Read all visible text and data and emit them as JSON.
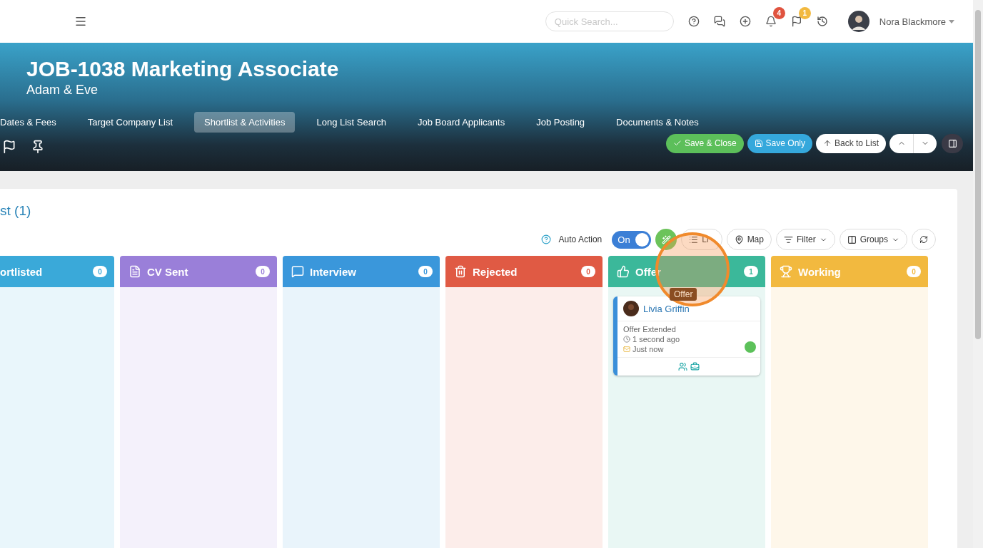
{
  "topbar": {
    "search": {
      "placeholder": "Quick Search..."
    },
    "badges": [
      {
        "kind": "bell",
        "count": "4",
        "color": "#e0533f"
      },
      {
        "kind": "flag",
        "count": "1",
        "color": "#f2b93f"
      }
    ],
    "user": {
      "name": "Nora Blackmore"
    }
  },
  "job": {
    "title": "JOB-1038 Marketing Associate",
    "company": "Adam & Eve"
  },
  "tabs": [
    {
      "label": "Dates & Fees",
      "selected": false
    },
    {
      "label": "Target Company List",
      "selected": false
    },
    {
      "label": "Shortlist & Activities",
      "selected": true
    },
    {
      "label": "Long List Search",
      "selected": false
    },
    {
      "label": "Job Board Applicants",
      "selected": false
    },
    {
      "label": "Job Posting",
      "selected": false
    },
    {
      "label": "Documents & Notes",
      "selected": false
    }
  ],
  "actions": [
    {
      "kind": "save-close",
      "label": "Save & Close"
    },
    {
      "kind": "save",
      "label": "Save Only"
    },
    {
      "kind": "back",
      "label": "Back to List"
    }
  ],
  "shortlist": {
    "title": "st (1)",
    "auto_action": {
      "label": "Auto Action",
      "state": "On",
      "on": true
    },
    "tools": [
      {
        "kind": "list",
        "label": "Li"
      },
      {
        "kind": "map",
        "label": "Map"
      },
      {
        "kind": "filter",
        "label": "Filter"
      },
      {
        "kind": "groups",
        "label": "Groups"
      }
    ],
    "tooltip": "Offer",
    "columns": [
      {
        "kind": "shortlisted",
        "name": "ortlisted",
        "count": "0",
        "color": "#3aa9d9"
      },
      {
        "kind": "cv",
        "name": "CV Sent",
        "count": "0",
        "color": "#9a7fd9"
      },
      {
        "kind": "interview",
        "name": "Interview",
        "count": "0",
        "color": "#3a97db"
      },
      {
        "kind": "rejected",
        "name": "Rejected",
        "count": "0",
        "color": "#e05a44"
      },
      {
        "kind": "offer",
        "name": "Offer",
        "count": "1",
        "color": "#3bb89a",
        "cards": [
          {
            "name": "Livia Griffin",
            "status": "Offer Extended",
            "time": "1 second ago",
            "email": "Just now",
            "color": "#5cc15a"
          }
        ]
      },
      {
        "kind": "working",
        "name": "Working",
        "count": "0",
        "color": "#f2b93f"
      }
    ]
  }
}
